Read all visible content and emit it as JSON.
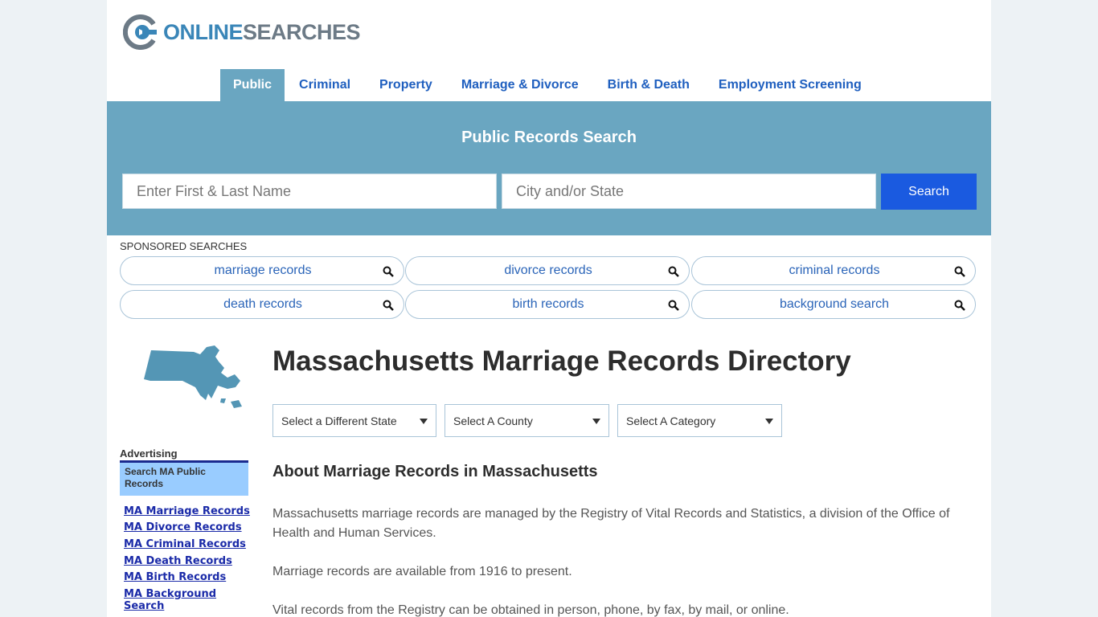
{
  "logo": {
    "part1": "ONLINE",
    "part2": "SEARCHES"
  },
  "nav": {
    "items": [
      {
        "label": "Public",
        "active": true
      },
      {
        "label": "Criminal"
      },
      {
        "label": "Property"
      },
      {
        "label": "Marriage & Divorce"
      },
      {
        "label": "Birth & Death"
      },
      {
        "label": "Employment Screening"
      }
    ]
  },
  "hero": {
    "title": "Public Records Search",
    "name_placeholder": "Enter First & Last Name",
    "city_placeholder": "City and/or State",
    "search_label": "Search"
  },
  "sponsored": {
    "label": "SPONSORED SEARCHES",
    "items": [
      "marriage records",
      "divorce records",
      "criminal records",
      "death records",
      "birth records",
      "background search"
    ]
  },
  "sidebar": {
    "advertising_label": "Advertising",
    "ad_box_text": "Search MA Public Records",
    "links": [
      "MA Marriage Records",
      "MA Divorce Records",
      "MA Criminal Records",
      "MA Death Records",
      "MA Birth Records",
      "MA Background Search"
    ]
  },
  "main": {
    "title": "Massachusetts Marriage Records Directory",
    "selects": [
      "Select a Different State",
      "Select A County",
      "Select A Category"
    ],
    "section_title": "About Marriage Records in Massachusetts",
    "paragraphs": [
      "Massachusetts marriage records are managed by the Registry of Vital Records and Statistics, a division of the Office of Health and Human Services.",
      "Marriage records are available from 1916 to present.",
      "Vital records from the Registry can be obtained in person, phone, by fax, by mail, or online."
    ]
  },
  "colors": {
    "hero": "#6aa6c1",
    "nav_text": "#1f5fbf",
    "search_button": "#1a5ae0",
    "ad_box": "#99ccff",
    "map": "#5496b5"
  }
}
